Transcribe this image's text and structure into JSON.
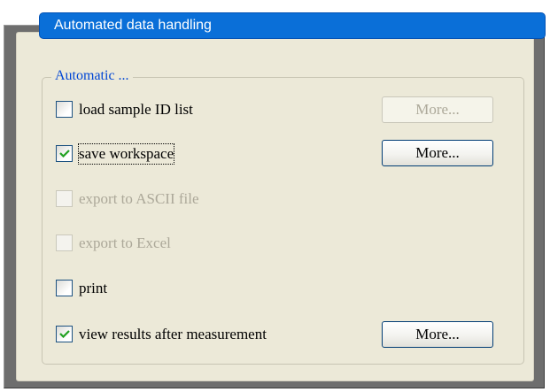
{
  "panel": {
    "title": "Automated data handling"
  },
  "group": {
    "legend": "Automatic ..."
  },
  "options": [
    {
      "label": "load sample ID list",
      "checked": false,
      "enabled": true
    },
    {
      "label": "save workspace",
      "checked": true,
      "enabled": true
    },
    {
      "label": "export to ASCII file",
      "checked": false,
      "enabled": false
    },
    {
      "label": "export to Excel",
      "checked": false,
      "enabled": false
    },
    {
      "label": "print",
      "checked": false,
      "enabled": true
    },
    {
      "label": "view results after measurement",
      "checked": true,
      "enabled": true
    }
  ],
  "buttons": {
    "load_sample_more": {
      "label": "More...",
      "enabled": false
    },
    "save_workspace_more": {
      "label": "More...",
      "enabled": true
    },
    "view_results_more": {
      "label": "More...",
      "enabled": true
    }
  },
  "colors": {
    "title_bar": "#0a6fd8",
    "panel_background": "#ece9d8",
    "legend_text": "#0046d5",
    "checkmark": "#21a121",
    "disabled_text": "#aca899"
  }
}
